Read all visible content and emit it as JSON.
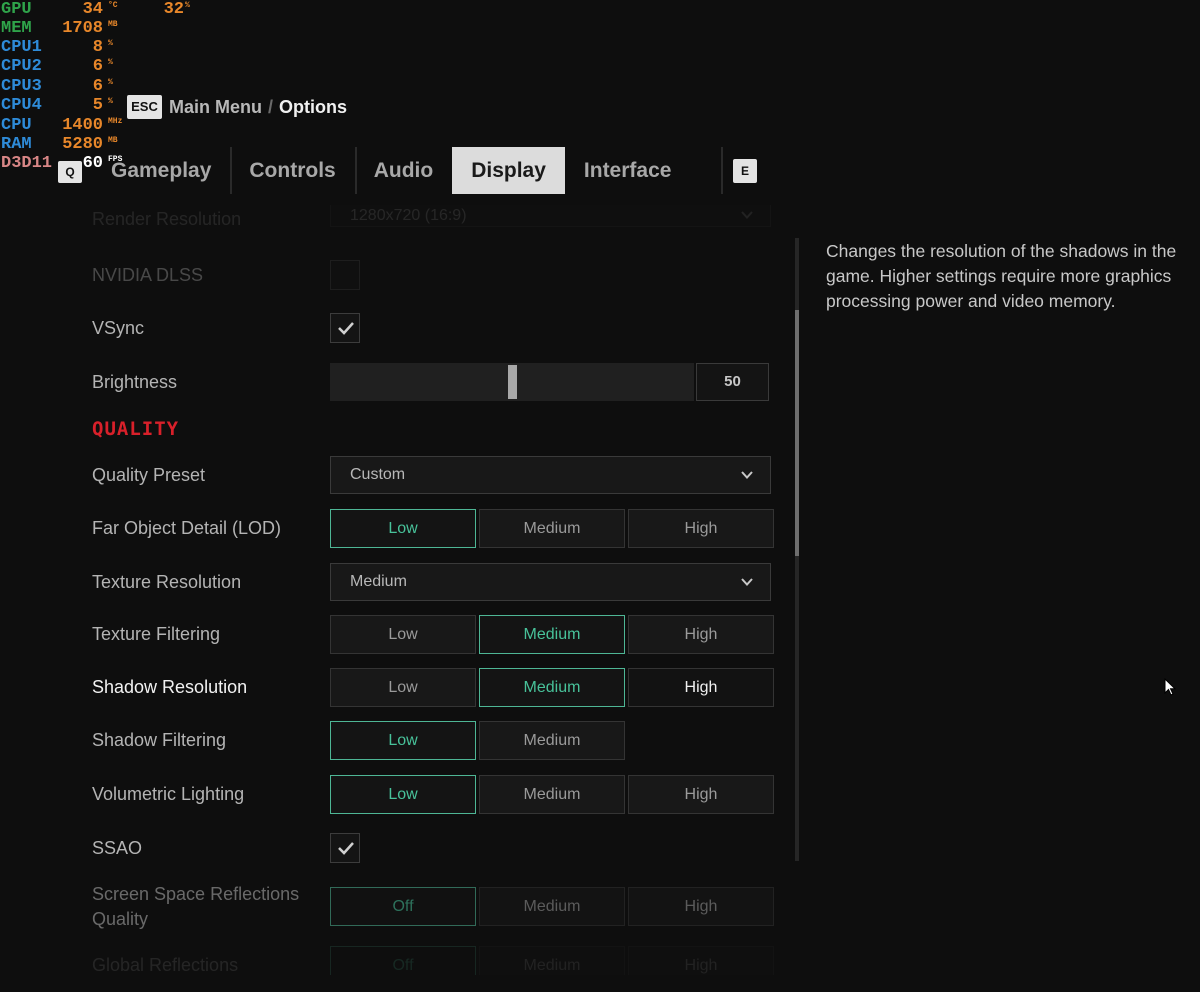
{
  "overlay": {
    "gpu": {
      "label": "GPU",
      "value": "34",
      "unit": "°C",
      "value2": "32",
      "unit2": "%"
    },
    "mem": {
      "label": "MEM",
      "value": "1708",
      "unit": "MB"
    },
    "cpu1": {
      "label": "CPU1",
      "value": "8",
      "unit": "%"
    },
    "cpu2": {
      "label": "CPU2",
      "value": "6",
      "unit": "%"
    },
    "cpu3": {
      "label": "CPU3",
      "value": "6",
      "unit": "%"
    },
    "cpu4": {
      "label": "CPU4",
      "value": "5",
      "unit": "%"
    },
    "cpu": {
      "label": "CPU",
      "value": "1400",
      "unit": "MHz"
    },
    "ram": {
      "label": "RAM",
      "value": "5280",
      "unit": "MB"
    },
    "d3d": {
      "label": "D3D11",
      "value": "60",
      "unit": "FPS"
    },
    "colors": {
      "green": "#2fa34a",
      "blue": "#2e8bd8",
      "orange": "#e8872a",
      "pink": "#d88686",
      "white": "#ffffff"
    }
  },
  "header": {
    "esc_key": "ESC",
    "breadcrumb_main": "Main Menu",
    "breadcrumb_sep": "/",
    "breadcrumb_current": "Options"
  },
  "tabs": {
    "prev_key": "Q",
    "next_key": "E",
    "items": [
      {
        "label": "Gameplay"
      },
      {
        "label": "Controls"
      },
      {
        "label": "Audio"
      },
      {
        "label": "Display"
      },
      {
        "label": "Interface"
      }
    ],
    "active": "Display"
  },
  "settings": {
    "render_resolution": {
      "label": "Render Resolution",
      "value": "1280x720 (16:9)"
    },
    "nvidia_dlss": {
      "label": "NVIDIA DLSS",
      "checked": false
    },
    "vsync": {
      "label": "VSync",
      "checked": true
    },
    "brightness": {
      "label": "Brightness",
      "value": "50",
      "fraction": 0.5
    },
    "quality_section": "QUALITY",
    "quality_preset": {
      "label": "Quality Preset",
      "value": "Custom"
    },
    "far_object_detail": {
      "label": "Far Object Detail (LOD)",
      "options": [
        "Low",
        "Medium",
        "High"
      ],
      "selected": "Low"
    },
    "texture_resolution": {
      "label": "Texture Resolution",
      "value": "Medium"
    },
    "texture_filtering": {
      "label": "Texture Filtering",
      "options": [
        "Low",
        "Medium",
        "High"
      ],
      "selected": "Medium"
    },
    "shadow_resolution": {
      "label": "Shadow Resolution",
      "options": [
        "Low",
        "Medium",
        "High"
      ],
      "selected": "Medium",
      "hovered": "High"
    },
    "shadow_filtering": {
      "label": "Shadow Filtering",
      "options": [
        "Low",
        "Medium"
      ],
      "selected": "Low"
    },
    "volumetric_lighting": {
      "label": "Volumetric Lighting",
      "options": [
        "Low",
        "Medium",
        "High"
      ],
      "selected": "Low"
    },
    "ssao": {
      "label": "SSAO",
      "checked": true
    },
    "ssr_quality": {
      "label_line1": "Screen Space Reflections",
      "label_line2": "Quality",
      "options": [
        "Off",
        "Medium",
        "High"
      ],
      "selected": "Off"
    },
    "global_reflections": {
      "label": "Global Reflections",
      "options": [
        "Off",
        "Medium",
        "High"
      ],
      "selected": "Off"
    }
  },
  "description": "Changes the resolution of the shadows in the game. Higher settings require more graphics processing power and video memory.",
  "accent_color": "#4eb695",
  "section_color": "#d8202a"
}
